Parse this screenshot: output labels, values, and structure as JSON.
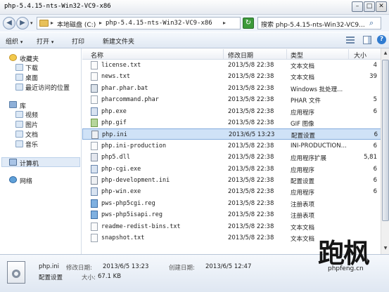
{
  "window": {
    "title": "php-5.4.15-nts-Win32-VC9-x86",
    "min_glyph": "–",
    "max_glyph": "□",
    "close_glyph": "✕"
  },
  "address": {
    "segments": [
      "本地磁盘 (C:)",
      "php-5.4.15-nts-Win32-VC9-x86"
    ],
    "separator": "▸",
    "search_placeholder": "搜索 php-5.4.15-nts-Win32-VC9..."
  },
  "toolbar": {
    "organize": "组织",
    "open": "打开",
    "print": "打印",
    "new_folder": "新建文件夹",
    "dropdown_glyph": "▾"
  },
  "navpane": {
    "favorites": "收藏夹",
    "favorites_items": [
      "下载",
      "桌面",
      "最近访问的位置"
    ],
    "libraries": "库",
    "libraries_items": [
      "视频",
      "图片",
      "文档",
      "音乐"
    ],
    "computer": "计算机",
    "network": "网络"
  },
  "columns": {
    "name": "名称",
    "date": "修改日期",
    "type": "类型",
    "size": "大小"
  },
  "files": [
    {
      "name": "license.txt",
      "date": "2013/5/8 22:38",
      "type": "文本文档",
      "size": "4",
      "icon": "txt"
    },
    {
      "name": "news.txt",
      "date": "2013/5/8 22:38",
      "type": "文本文档",
      "size": "39",
      "icon": "txt"
    },
    {
      "name": "phar.phar.bat",
      "date": "2013/5/8 22:38",
      "type": "Windows 批处理...",
      "size": "",
      "icon": "bat"
    },
    {
      "name": "pharcommand.phar",
      "date": "2013/5/8 22:38",
      "type": "PHAR 文件",
      "size": "5",
      "icon": "txt"
    },
    {
      "name": "php.exe",
      "date": "2013/5/8 22:38",
      "type": "应用程序",
      "size": "6",
      "icon": "exe"
    },
    {
      "name": "php.gif",
      "date": "2013/5/8 22:38",
      "type": "GIF 图像",
      "size": "",
      "icon": "gif"
    },
    {
      "name": "php.ini",
      "date": "2013/6/5 13:23",
      "type": "配置设置",
      "size": "6",
      "icon": "ini",
      "selected": true
    },
    {
      "name": "php.ini-production",
      "date": "2013/5/8 22:38",
      "type": "INI-PRODUCTION...",
      "size": "6",
      "icon": "txt"
    },
    {
      "name": "php5.dll",
      "date": "2013/5/8 22:38",
      "type": "应用程序扩展",
      "size": "5,81",
      "icon": "dll"
    },
    {
      "name": "php-cgi.exe",
      "date": "2013/5/8 22:38",
      "type": "应用程序",
      "size": "6",
      "icon": "exe"
    },
    {
      "name": "php-development.ini",
      "date": "2013/5/8 22:38",
      "type": "配置设置",
      "size": "6",
      "icon": "ini"
    },
    {
      "name": "php-win.exe",
      "date": "2013/5/8 22:38",
      "type": "应用程序",
      "size": "6",
      "icon": "exe"
    },
    {
      "name": "pws-php5cgi.reg",
      "date": "2013/5/8 22:38",
      "type": "注册表项",
      "size": "",
      "icon": "reg"
    },
    {
      "name": "pws-php5isapi.reg",
      "date": "2013/5/8 22:38",
      "type": "注册表项",
      "size": "",
      "icon": "reg"
    },
    {
      "name": "readme-redist-bins.txt",
      "date": "2013/5/8 22:38",
      "type": "文本文档",
      "size": "",
      "icon": "txt"
    },
    {
      "name": "snapshot.txt",
      "date": "2013/5/8 22:38",
      "type": "文本文档",
      "size": "",
      "icon": "txt"
    }
  ],
  "details": {
    "filename": "php.ini",
    "modified_label": "修改日期:",
    "modified": "2013/6/5 13:23",
    "created_label": "创建日期:",
    "created": "2013/6/5 12:47",
    "type": "配置设置",
    "size_label": "大小:",
    "size": "67.1 KB"
  },
  "watermark": {
    "chars": "跑枫",
    "url": "phpfeng.cn"
  },
  "colors": {
    "selection": "#cfe2f7",
    "selection_border": "#84acdd",
    "toolbar_bg": "#e0e8f3"
  }
}
